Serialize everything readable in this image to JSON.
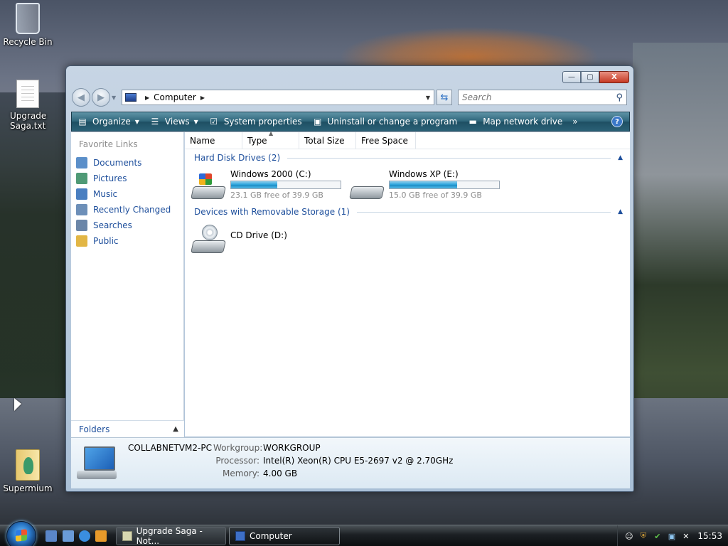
{
  "desktop": {
    "icons": [
      {
        "label": "Recycle Bin",
        "icon": "recycle-bin-icon"
      },
      {
        "label": "Upgrade Saga.txt",
        "icon": "text-document-icon"
      },
      {
        "label": "Supermium",
        "icon": "folder-icon"
      }
    ]
  },
  "window": {
    "caption_buttons": {
      "minimize": "—",
      "maximize": "▢",
      "close": "X"
    },
    "address": {
      "location": "Computer",
      "search_placeholder": "Search"
    },
    "command_bar": {
      "organize": "Organize",
      "views": "Views",
      "system_properties": "System properties",
      "uninstall": "Uninstall or change a program",
      "map_drive": "Map network drive",
      "more": "»",
      "help": "?"
    },
    "nav_pane": {
      "title": "Favorite Links",
      "items": [
        {
          "label": "Documents",
          "icon": "documents-icon",
          "color": "#5b8fc9"
        },
        {
          "label": "Pictures",
          "icon": "pictures-icon",
          "color": "#4f9a76"
        },
        {
          "label": "Music",
          "icon": "music-icon",
          "color": "#4a7fc1"
        },
        {
          "label": "Recently Changed",
          "icon": "recent-icon",
          "color": "#6d8fb8"
        },
        {
          "label": "Searches",
          "icon": "searches-icon",
          "color": "#6b86a8"
        },
        {
          "label": "Public",
          "icon": "public-folder-icon",
          "color": "#e2b645"
        }
      ],
      "folders_label": "Folders"
    },
    "columns": [
      "Name",
      "Type",
      "Total Size",
      "Free Space"
    ],
    "groups": {
      "hard_disks": {
        "title": "Hard Disk Drives (2)",
        "drives": [
          {
            "label": "Windows 2000 (C:)",
            "free_text": "23.1 GB free of 39.9 GB",
            "used_fraction": 0.42
          },
          {
            "label": "Windows XP (E:)",
            "free_text": "15.0 GB free of 39.9 GB",
            "used_fraction": 0.62
          }
        ]
      },
      "removable": {
        "title": "Devices with Removable Storage (1)",
        "drives": [
          {
            "label": "CD Drive (D:)"
          }
        ]
      }
    },
    "details": {
      "computer_name": "COLLABNETVM2-PC",
      "workgroup_label": "Workgroup:",
      "workgroup": "WORKGROUP",
      "processor_label": "Processor:",
      "processor": "Intel(R) Xeon(R) CPU E5-2697 v2 @ 2.70GHz",
      "memory_label": "Memory:",
      "memory": "4.00 GB"
    }
  },
  "taskbar": {
    "buttons": [
      {
        "label": "Upgrade Saga - Not...",
        "icon": "notepad-icon"
      },
      {
        "label": "Computer",
        "icon": "computer-icon"
      }
    ],
    "clock": "15:53"
  },
  "colors": {
    "accent": "#1e4f9c",
    "command_bar": "#2d6479",
    "meter": "#26a0da"
  }
}
